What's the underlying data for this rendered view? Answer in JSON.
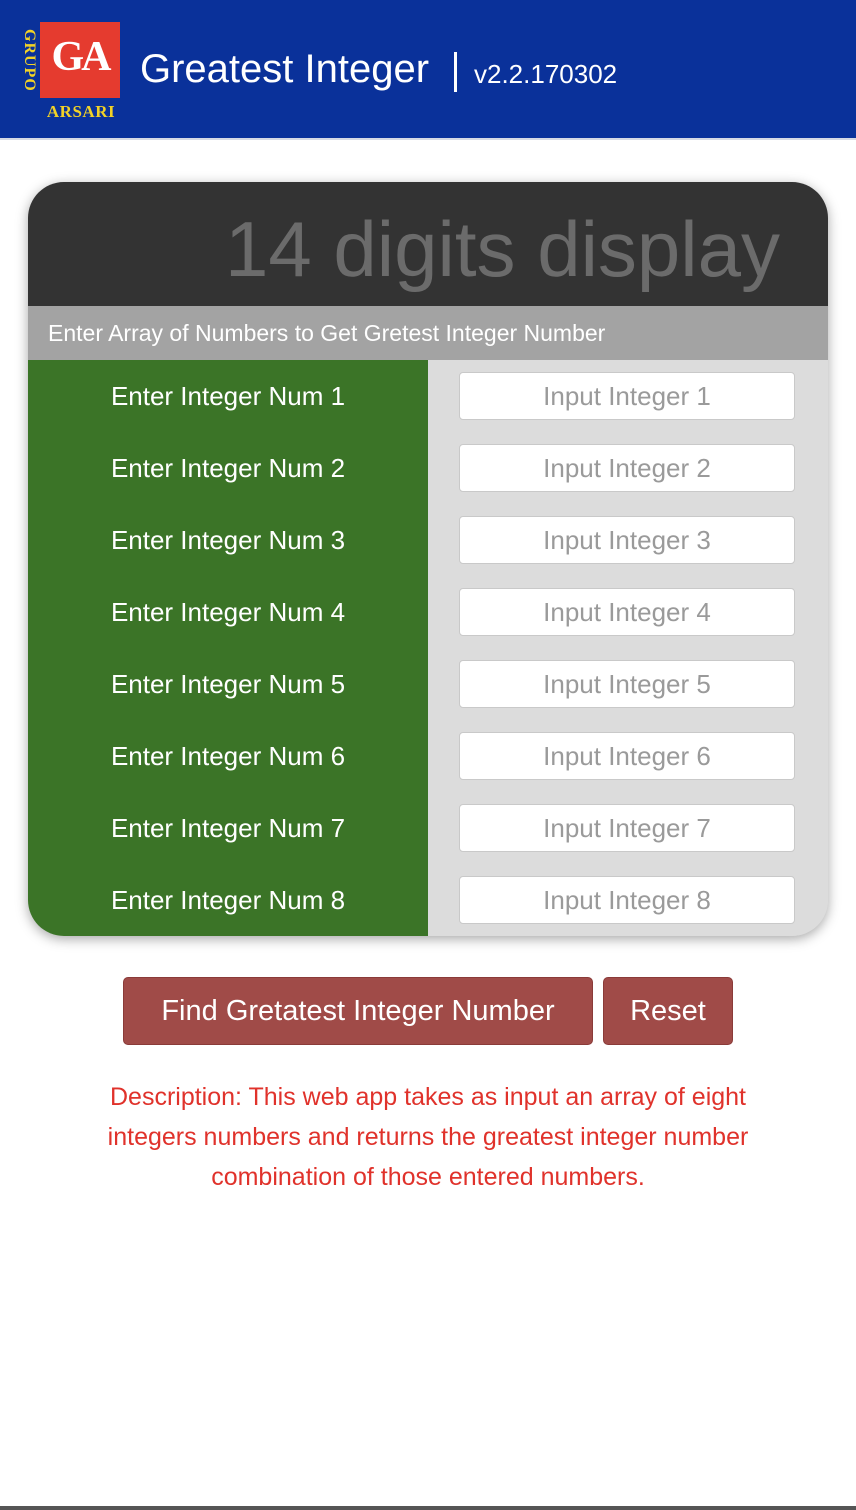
{
  "header": {
    "logo": {
      "grupo": "GRUPO",
      "initials": "GA",
      "name": "ARSARI"
    },
    "title": "Greatest Integer",
    "separator": "|",
    "version": "v2.2.170302"
  },
  "display": {
    "text": "14 digits display"
  },
  "instruction": "Enter Array of Numbers to Get Gretest Integer Number",
  "rows": [
    {
      "label": "Enter Integer Num 1",
      "placeholder": "Input Integer 1",
      "value": ""
    },
    {
      "label": "Enter Integer Num 2",
      "placeholder": "Input Integer 2",
      "value": ""
    },
    {
      "label": "Enter Integer Num 3",
      "placeholder": "Input Integer 3",
      "value": ""
    },
    {
      "label": "Enter Integer Num 4",
      "placeholder": "Input Integer 4",
      "value": ""
    },
    {
      "label": "Enter Integer Num 5",
      "placeholder": "Input Integer 5",
      "value": ""
    },
    {
      "label": "Enter Integer Num 6",
      "placeholder": "Input Integer 6",
      "value": ""
    },
    {
      "label": "Enter Integer Num 7",
      "placeholder": "Input Integer 7",
      "value": ""
    },
    {
      "label": "Enter Integer Num 8",
      "placeholder": "Input Integer 8",
      "value": ""
    }
  ],
  "buttons": {
    "find_label": "Find Gretatest Integer Number",
    "reset_label": "Reset"
  },
  "description": "Description: This web app takes as input an array of eight integers numbers and returns the greatest integer number combination of those entered numbers.",
  "colors": {
    "header_bg": "#0a319a",
    "logo_red": "#e53b2f",
    "logo_yellow": "#f2d227",
    "display_bg": "#333333",
    "instruction_bg": "#a3a3a3",
    "label_green": "#3b7427",
    "button_red": "#a04b48",
    "description_red": "#e0322b"
  }
}
